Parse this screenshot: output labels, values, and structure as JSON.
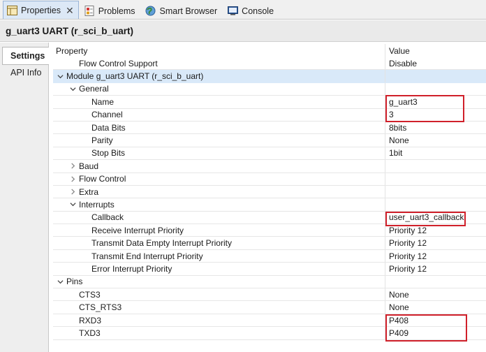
{
  "tabs": [
    {
      "label": "Properties",
      "icon": "properties-icon",
      "active": true
    },
    {
      "label": "Problems",
      "icon": "problems-icon",
      "active": false
    },
    {
      "label": "Smart Browser",
      "icon": "smart-browser-icon",
      "active": false
    },
    {
      "label": "Console",
      "icon": "console-icon",
      "active": false
    }
  ],
  "title": "g_uart3 UART (r_sci_b_uart)",
  "side_tabs": [
    {
      "label": "Settings",
      "active": true
    },
    {
      "label": "API Info",
      "active": false
    }
  ],
  "table": {
    "header_property": "Property",
    "header_value": "Value",
    "rows": [
      {
        "label": "Flow Control Support",
        "value": "Disable",
        "level": 1,
        "expander": "none"
      },
      {
        "label": "Module g_uart3 UART (r_sci_b_uart)",
        "value": "",
        "level": 0,
        "expander": "down",
        "selected": true
      },
      {
        "label": "General",
        "value": "",
        "level": 1,
        "expander": "down"
      },
      {
        "label": "Name",
        "value": "g_uart3",
        "level": 2,
        "expander": "none"
      },
      {
        "label": "Channel",
        "value": "3",
        "level": 2,
        "expander": "none"
      },
      {
        "label": "Data Bits",
        "value": "8bits",
        "level": 2,
        "expander": "none"
      },
      {
        "label": "Parity",
        "value": "None",
        "level": 2,
        "expander": "none"
      },
      {
        "label": "Stop Bits",
        "value": "1bit",
        "level": 2,
        "expander": "none"
      },
      {
        "label": "Baud",
        "value": "",
        "level": 1,
        "expander": "right"
      },
      {
        "label": "Flow Control",
        "value": "",
        "level": 1,
        "expander": "right"
      },
      {
        "label": "Extra",
        "value": "",
        "level": 1,
        "expander": "right"
      },
      {
        "label": "Interrupts",
        "value": "",
        "level": 1,
        "expander": "down"
      },
      {
        "label": "Callback",
        "value": "user_uart3_callback",
        "level": 2,
        "expander": "none"
      },
      {
        "label": "Receive Interrupt Priority",
        "value": "Priority 12",
        "level": 2,
        "expander": "none"
      },
      {
        "label": "Transmit Data Empty Interrupt Priority",
        "value": "Priority 12",
        "level": 2,
        "expander": "none"
      },
      {
        "label": "Transmit End Interrupt Priority",
        "value": "Priority 12",
        "level": 2,
        "expander": "none"
      },
      {
        "label": "Error Interrupt Priority",
        "value": "Priority 12",
        "level": 2,
        "expander": "none"
      },
      {
        "label": "Pins",
        "value": "",
        "level": 0,
        "expander": "down"
      },
      {
        "label": "CTS3",
        "value": "None",
        "level": 1,
        "expander": "none"
      },
      {
        "label": "CTS_RTS3",
        "value": "None",
        "level": 1,
        "expander": "none"
      },
      {
        "label": "RXD3",
        "value": "P408",
        "level": 1,
        "expander": "none"
      },
      {
        "label": "TXD3",
        "value": "P409",
        "level": 1,
        "expander": "none"
      }
    ]
  },
  "colors": {
    "highlight": "#d0202a",
    "selection": "#d9e9f9",
    "active_tab": "#dce8f6"
  }
}
